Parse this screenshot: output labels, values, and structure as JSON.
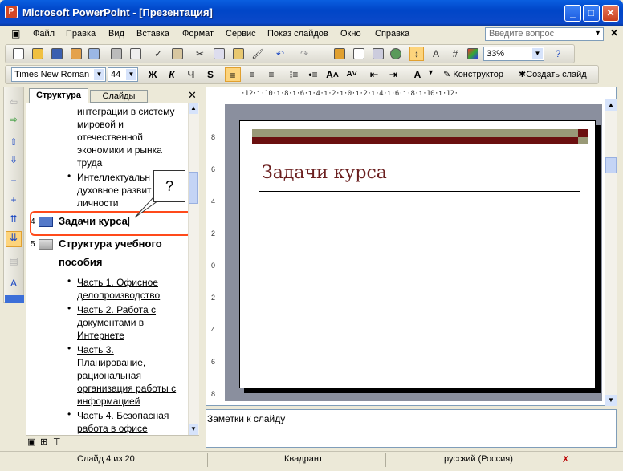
{
  "window": {
    "title": "Microsoft PowerPoint - [Презентация]",
    "min": "_",
    "max": "□",
    "close": "✕"
  },
  "menu": {
    "items": [
      "Файл",
      "Правка",
      "Вид",
      "Вставка",
      "Формат",
      "Сервис",
      "Показ слайдов",
      "Окно",
      "Справка"
    ],
    "help_placeholder": "Введите вопрос",
    "close": "✕"
  },
  "toolbar": {
    "zoom": "33%",
    "font_name": "Times New Roman",
    "font_size": "44",
    "bold": "Ж",
    "italic": "К",
    "underline": "Ч",
    "shadow": "S",
    "designer_label": "Конструктор",
    "new_slide_label": "Создать слайд"
  },
  "tabs": {
    "structure": "Структура",
    "slides": "Слайды",
    "close": "✕"
  },
  "outline": {
    "slide3_text": [
      "интеграции в систему",
      "мировой и",
      "отечественной",
      "экономики и рынка",
      "труда"
    ],
    "slide3_bullet2": [
      "Интеллектуальн",
      "духовное развит",
      "личности"
    ],
    "slide4": {
      "num": "4",
      "title": "Задачи курса"
    },
    "slide5": {
      "num": "5",
      "title_line1": "Структура учебного",
      "title_line2": "пособия"
    },
    "parts": [
      [
        "Часть 1. Офисное",
        "делопроизводство"
      ],
      [
        "Часть 2. Работа с",
        "документами в",
        "Интернете"
      ],
      [
        "Часть 3.",
        "Планирование,",
        "рациональная",
        "организация работы с",
        "информацией"
      ],
      [
        "Часть 4. Безопасная",
        "работа в офисе"
      ]
    ],
    "callout": "?"
  },
  "ruler_h": "·12·ı·10·ı·8·ı·6·ı·4·ı·2·ı·0·ı·2·ı·4·ı·6·ı·8·ı·10·ı·12·",
  "slide": {
    "title": "Задачи курса"
  },
  "notes": {
    "placeholder": "Заметки к слайду"
  },
  "status": {
    "slide": "Слайд 4 из 20",
    "design": "Квадрант",
    "language": "русский (Россия)"
  }
}
